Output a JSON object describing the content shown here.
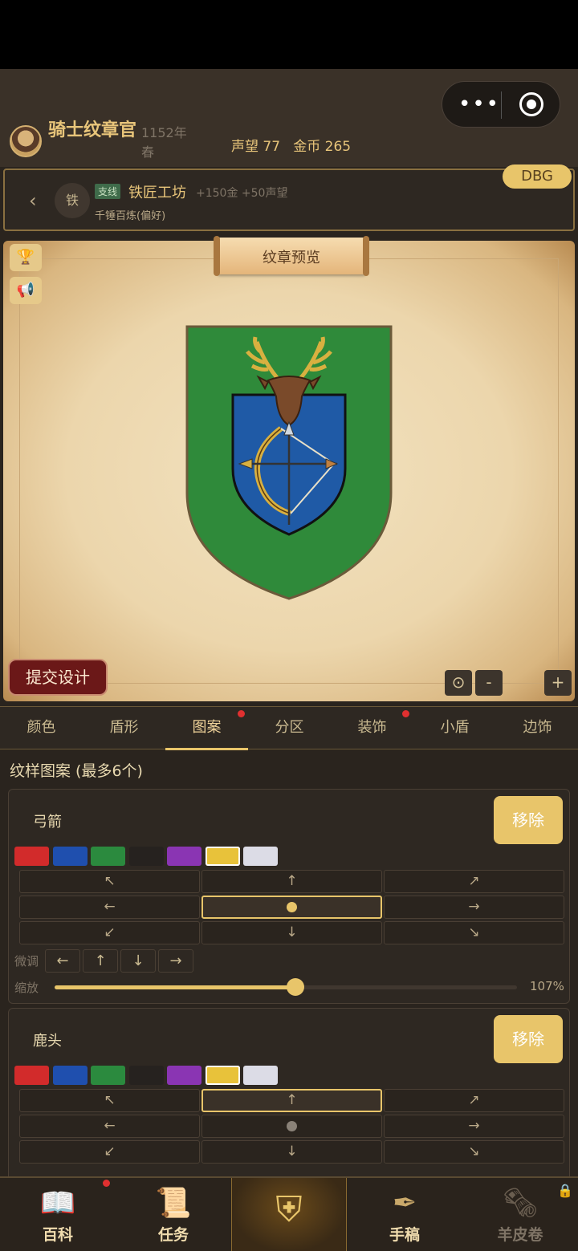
{
  "header": {
    "title": "骑士纹章官",
    "year": "1152年春",
    "reputation": "声望 77",
    "gold": "金币 265",
    "capsule_more": "•••"
  },
  "quest": {
    "icon_text": "铁",
    "tag": "支线",
    "name": "铁匠工坊",
    "reward": "+150金 +50声望",
    "subtitle": "千锤百炼(偏好)",
    "debug_badge": "DBG"
  },
  "preview": {
    "scroll_title": "纹章预览",
    "submit_label": "提交设计",
    "zoom_minus": "-",
    "zoom_plus": "+"
  },
  "tabs": [
    {
      "label": "颜色"
    },
    {
      "label": "盾形"
    },
    {
      "label": "图案",
      "active": true,
      "badge": true
    },
    {
      "label": "分区"
    },
    {
      "label": "装饰",
      "badge": true
    },
    {
      "label": "小盾"
    },
    {
      "label": "边饰"
    }
  ],
  "section_title": "纹样图案 (最多6个)",
  "palette": [
    "#d22b2b",
    "#1f4fae",
    "#2b8a3e",
    "#26221f",
    "#8a35b3",
    "#e8c23a",
    "#dcdce6"
  ],
  "charges": [
    {
      "name": "弓箭",
      "remove_label": "移除",
      "selected_color": "#e8c23a",
      "position": "center",
      "nudge_label": "微调",
      "scale_label": "缩放",
      "scale_value": "107%",
      "scale_fraction": 0.52
    },
    {
      "name": "鹿头",
      "remove_label": "移除",
      "selected_color": "#e8c23a",
      "position": "top"
    }
  ],
  "grid_arrows": [
    "↖",
    "↑",
    "↗",
    "←",
    "●",
    "→",
    "↙",
    "↓",
    "↘"
  ],
  "nudge_arrows": [
    "←",
    "↑",
    "↓",
    "→"
  ],
  "bottom_nav": [
    {
      "label": "百科",
      "icon": "book-icon",
      "badge": true
    },
    {
      "label": "任务",
      "icon": "scroll-list-icon"
    },
    {
      "label": "",
      "icon": "shield-cross-icon",
      "active": true
    },
    {
      "label": "手稿",
      "icon": "quill-icon"
    },
    {
      "label": "羊皮卷",
      "icon": "parchment-icon",
      "locked": true
    }
  ],
  "colors": {
    "accent": "#e8c56a",
    "field": "#2f8a3a",
    "inner_shield": "#1f5aa6",
    "submit": "#6b1818"
  }
}
